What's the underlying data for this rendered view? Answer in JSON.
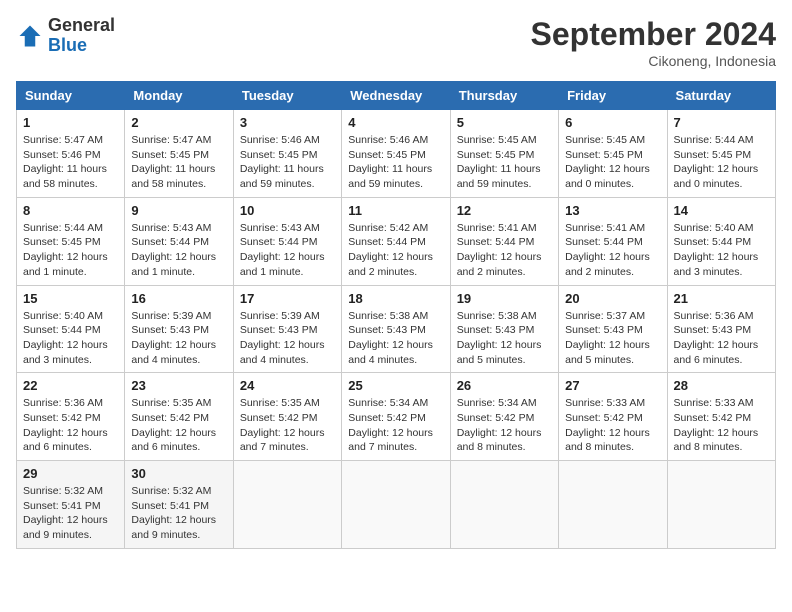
{
  "header": {
    "logo_line1": "General",
    "logo_line2": "Blue",
    "month": "September 2024",
    "location": "Cikoneng, Indonesia"
  },
  "weekdays": [
    "Sunday",
    "Monday",
    "Tuesday",
    "Wednesday",
    "Thursday",
    "Friday",
    "Saturday"
  ],
  "weeks": [
    [
      {
        "day": "1",
        "info": "Sunrise: 5:47 AM\nSunset: 5:46 PM\nDaylight: 11 hours\nand 58 minutes."
      },
      {
        "day": "2",
        "info": "Sunrise: 5:47 AM\nSunset: 5:45 PM\nDaylight: 11 hours\nand 58 minutes."
      },
      {
        "day": "3",
        "info": "Sunrise: 5:46 AM\nSunset: 5:45 PM\nDaylight: 11 hours\nand 59 minutes."
      },
      {
        "day": "4",
        "info": "Sunrise: 5:46 AM\nSunset: 5:45 PM\nDaylight: 11 hours\nand 59 minutes."
      },
      {
        "day": "5",
        "info": "Sunrise: 5:45 AM\nSunset: 5:45 PM\nDaylight: 11 hours\nand 59 minutes."
      },
      {
        "day": "6",
        "info": "Sunrise: 5:45 AM\nSunset: 5:45 PM\nDaylight: 12 hours\nand 0 minutes."
      },
      {
        "day": "7",
        "info": "Sunrise: 5:44 AM\nSunset: 5:45 PM\nDaylight: 12 hours\nand 0 minutes."
      }
    ],
    [
      {
        "day": "8",
        "info": "Sunrise: 5:44 AM\nSunset: 5:45 PM\nDaylight: 12 hours\nand 1 minute."
      },
      {
        "day": "9",
        "info": "Sunrise: 5:43 AM\nSunset: 5:44 PM\nDaylight: 12 hours\nand 1 minute."
      },
      {
        "day": "10",
        "info": "Sunrise: 5:43 AM\nSunset: 5:44 PM\nDaylight: 12 hours\nand 1 minute."
      },
      {
        "day": "11",
        "info": "Sunrise: 5:42 AM\nSunset: 5:44 PM\nDaylight: 12 hours\nand 2 minutes."
      },
      {
        "day": "12",
        "info": "Sunrise: 5:41 AM\nSunset: 5:44 PM\nDaylight: 12 hours\nand 2 minutes."
      },
      {
        "day": "13",
        "info": "Sunrise: 5:41 AM\nSunset: 5:44 PM\nDaylight: 12 hours\nand 2 minutes."
      },
      {
        "day": "14",
        "info": "Sunrise: 5:40 AM\nSunset: 5:44 PM\nDaylight: 12 hours\nand 3 minutes."
      }
    ],
    [
      {
        "day": "15",
        "info": "Sunrise: 5:40 AM\nSunset: 5:44 PM\nDaylight: 12 hours\nand 3 minutes."
      },
      {
        "day": "16",
        "info": "Sunrise: 5:39 AM\nSunset: 5:43 PM\nDaylight: 12 hours\nand 4 minutes."
      },
      {
        "day": "17",
        "info": "Sunrise: 5:39 AM\nSunset: 5:43 PM\nDaylight: 12 hours\nand 4 minutes."
      },
      {
        "day": "18",
        "info": "Sunrise: 5:38 AM\nSunset: 5:43 PM\nDaylight: 12 hours\nand 4 minutes."
      },
      {
        "day": "19",
        "info": "Sunrise: 5:38 AM\nSunset: 5:43 PM\nDaylight: 12 hours\nand 5 minutes."
      },
      {
        "day": "20",
        "info": "Sunrise: 5:37 AM\nSunset: 5:43 PM\nDaylight: 12 hours\nand 5 minutes."
      },
      {
        "day": "21",
        "info": "Sunrise: 5:36 AM\nSunset: 5:43 PM\nDaylight: 12 hours\nand 6 minutes."
      }
    ],
    [
      {
        "day": "22",
        "info": "Sunrise: 5:36 AM\nSunset: 5:42 PM\nDaylight: 12 hours\nand 6 minutes."
      },
      {
        "day": "23",
        "info": "Sunrise: 5:35 AM\nSunset: 5:42 PM\nDaylight: 12 hours\nand 6 minutes."
      },
      {
        "day": "24",
        "info": "Sunrise: 5:35 AM\nSunset: 5:42 PM\nDaylight: 12 hours\nand 7 minutes."
      },
      {
        "day": "25",
        "info": "Sunrise: 5:34 AM\nSunset: 5:42 PM\nDaylight: 12 hours\nand 7 minutes."
      },
      {
        "day": "26",
        "info": "Sunrise: 5:34 AM\nSunset: 5:42 PM\nDaylight: 12 hours\nand 8 minutes."
      },
      {
        "day": "27",
        "info": "Sunrise: 5:33 AM\nSunset: 5:42 PM\nDaylight: 12 hours\nand 8 minutes."
      },
      {
        "day": "28",
        "info": "Sunrise: 5:33 AM\nSunset: 5:42 PM\nDaylight: 12 hours\nand 8 minutes."
      }
    ],
    [
      {
        "day": "29",
        "info": "Sunrise: 5:32 AM\nSunset: 5:41 PM\nDaylight: 12 hours\nand 9 minutes."
      },
      {
        "day": "30",
        "info": "Sunrise: 5:32 AM\nSunset: 5:41 PM\nDaylight: 12 hours\nand 9 minutes."
      },
      {
        "day": "",
        "info": ""
      },
      {
        "day": "",
        "info": ""
      },
      {
        "day": "",
        "info": ""
      },
      {
        "day": "",
        "info": ""
      },
      {
        "day": "",
        "info": ""
      }
    ]
  ]
}
